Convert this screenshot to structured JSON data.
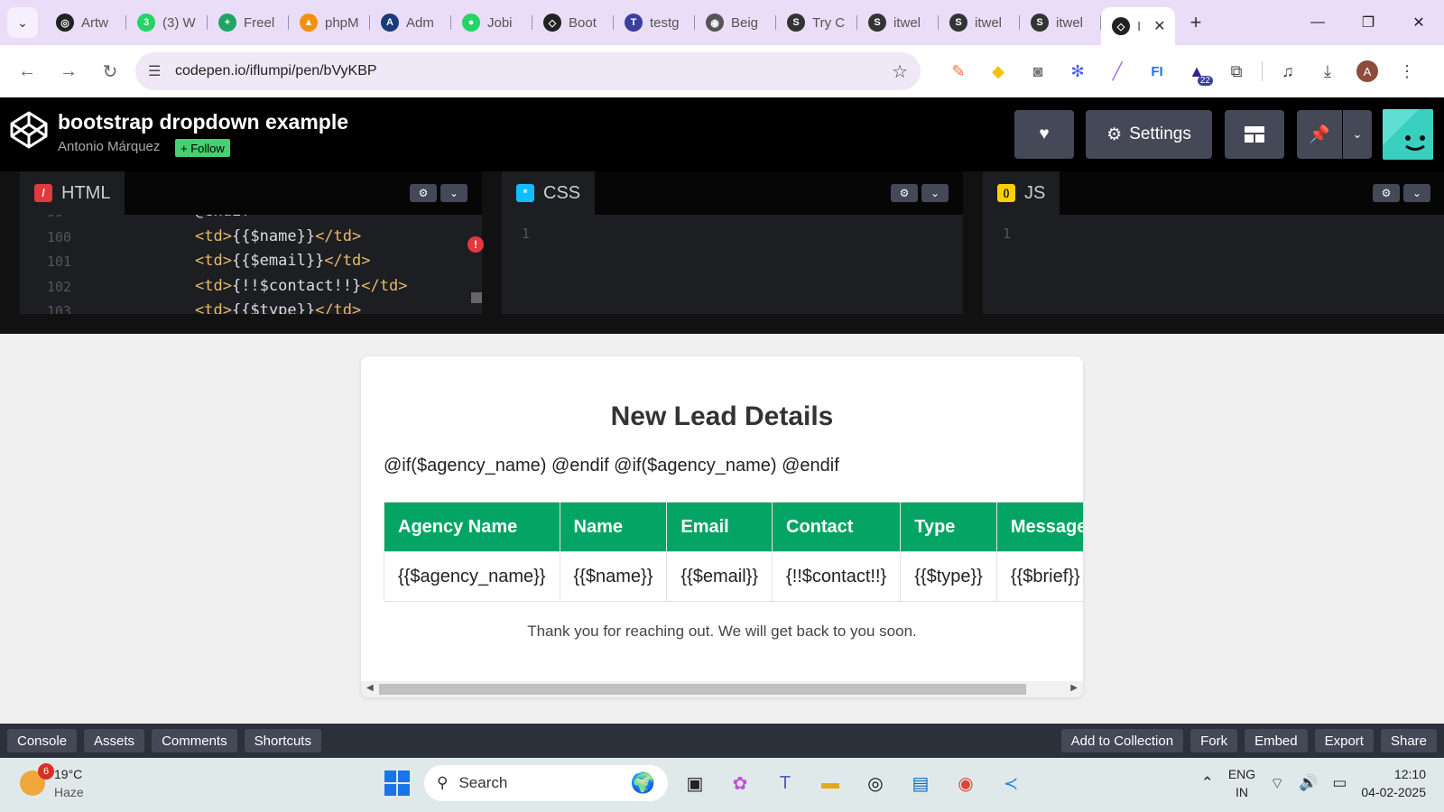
{
  "browser": {
    "tabs": [
      {
        "label": "Artw",
        "color": "#222222",
        "glyph": "◎"
      },
      {
        "label": "(3) W",
        "color": "#25d366",
        "glyph": "3"
      },
      {
        "label": "Freel",
        "color": "#1fa463",
        "glyph": "+"
      },
      {
        "label": "phpM",
        "color": "#f29111",
        "glyph": "▲"
      },
      {
        "label": "Adm",
        "color": "#1a3a7a",
        "glyph": "A"
      },
      {
        "label": "Jobi",
        "color": "#25d366",
        "glyph": "●"
      },
      {
        "label": "Boot",
        "color": "#222222",
        "glyph": "◇"
      },
      {
        "label": "testg",
        "color": "#3b3f9e",
        "glyph": "T"
      },
      {
        "label": "Beig",
        "color": "#555555",
        "glyph": "◉"
      },
      {
        "label": "Try C",
        "color": "#333333",
        "glyph": "S"
      },
      {
        "label": "itwel",
        "color": "#333333",
        "glyph": "S"
      },
      {
        "label": "itwel",
        "color": "#333333",
        "glyph": "S"
      },
      {
        "label": "itwel",
        "color": "#333333",
        "glyph": "S"
      }
    ],
    "active_tab": {
      "label": "I",
      "glyph": "◇"
    },
    "url": "codepen.io/iflumpi/pen/bVyKBP",
    "extensions_badge": "22",
    "profile_initial": "A"
  },
  "codepen": {
    "title": "bootstrap dropdown example",
    "author": "Antonio Márquez",
    "follow_label": "+ Follow",
    "settings_label": "Settings",
    "editors": {
      "html": {
        "label": "HTML",
        "color": "#e0393e",
        "glyph": "/"
      },
      "css": {
        "label": "CSS",
        "color": "#0ebeff",
        "glyph": "*"
      },
      "js": {
        "label": "JS",
        "color": "#fcd000",
        "glyph": "()"
      }
    },
    "html_code": [
      {
        "num": "99",
        "open": "",
        "text": "@endif",
        "close": ""
      },
      {
        "num": "100",
        "open": "<td>",
        "text": "{{$name}}",
        "close": "</td>"
      },
      {
        "num": "101",
        "open": "<td>",
        "text": "{{$email}}",
        "close": "</td>"
      },
      {
        "num": "102",
        "open": "<td>",
        "text": "{!!$contact!!}",
        "close": "</td>"
      },
      {
        "num": "103",
        "open": "<td>",
        "text": "{{$type}}",
        "close": "</td>"
      }
    ],
    "css_line": "1",
    "js_line": "1",
    "footer_left": [
      "Console",
      "Assets",
      "Comments",
      "Shortcuts"
    ],
    "footer_right": [
      "Add to Collection",
      "Fork",
      "Embed",
      "Export",
      "Share"
    ]
  },
  "preview": {
    "heading": "New Lead Details",
    "template_line": "@if($agency_name) @endif @if($agency_name) @endif",
    "table": {
      "headers": [
        "Agency Name",
        "Name",
        "Email",
        "Contact",
        "Type",
        "Message"
      ],
      "row": [
        "{{$agency_name}}",
        "{{$name}}",
        "{{$email}}",
        "{!!$contact!!}",
        "{{$type}}",
        "{{$brief}}"
      ]
    },
    "thanks": "Thank you for reaching out. We will get back to you soon."
  },
  "taskbar": {
    "weather_badge": "6",
    "temperature": "19°C",
    "condition": "Haze",
    "search_placeholder": "Search",
    "lang_line1": "ENG",
    "lang_line2": "IN",
    "time": "12:10",
    "date": "04-02-2025"
  }
}
